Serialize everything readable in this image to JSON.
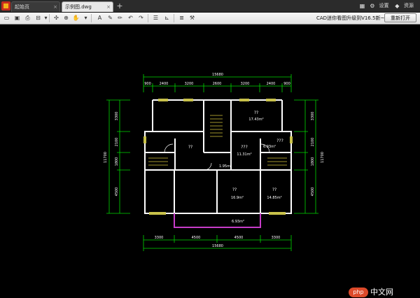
{
  "tabs": [
    {
      "label": "起始页",
      "active": false
    },
    {
      "label": "示例图.dwg",
      "active": true
    }
  ],
  "tab_close": "×",
  "new_tab": "+",
  "top_right": {
    "settings": "设置",
    "resources": "资源"
  },
  "toolbar": {
    "update_text": "CAD迷你看图升级到V16.5新~",
    "reopen_label": "重新打开"
  },
  "drawing": {
    "top_total": "15680",
    "top_dims": [
      "900",
      "2400",
      "3200",
      "2600",
      "3200",
      "2400",
      "900"
    ],
    "bottom_dims": [
      "3300",
      "4500",
      "4500",
      "3300"
    ],
    "bottom_total": "15680",
    "left_dims": [
      "3300",
      "2100",
      "1800",
      "4500"
    ],
    "left_total": "11700",
    "right_dims": [
      "3300",
      "2100",
      "1800",
      "4500"
    ],
    "right_total": "11700",
    "room_labels": [
      {
        "name": "??",
        "area": "17.43m²"
      },
      {
        "name": "???",
        "area": "11.31m²"
      },
      {
        "name": "??",
        "area": ""
      },
      {
        "name": "??",
        "area": "6.93m²"
      },
      {
        "name": "??",
        "area": "16.9m²"
      },
      {
        "name": "??",
        "area": "14.85m²"
      },
      {
        "name": "",
        "area": "6.93m²"
      },
      {
        "name": "",
        "area": "1.95m²"
      },
      {
        "name": "???",
        "area": ""
      }
    ]
  },
  "watermark": {
    "badge": "php",
    "text": "中文网"
  },
  "colors": {
    "walls": "#ffffff",
    "dims": "#00d800",
    "windows": "#c9c24a",
    "balcony": "#c73cc9",
    "stairs": "#d6c43a"
  }
}
